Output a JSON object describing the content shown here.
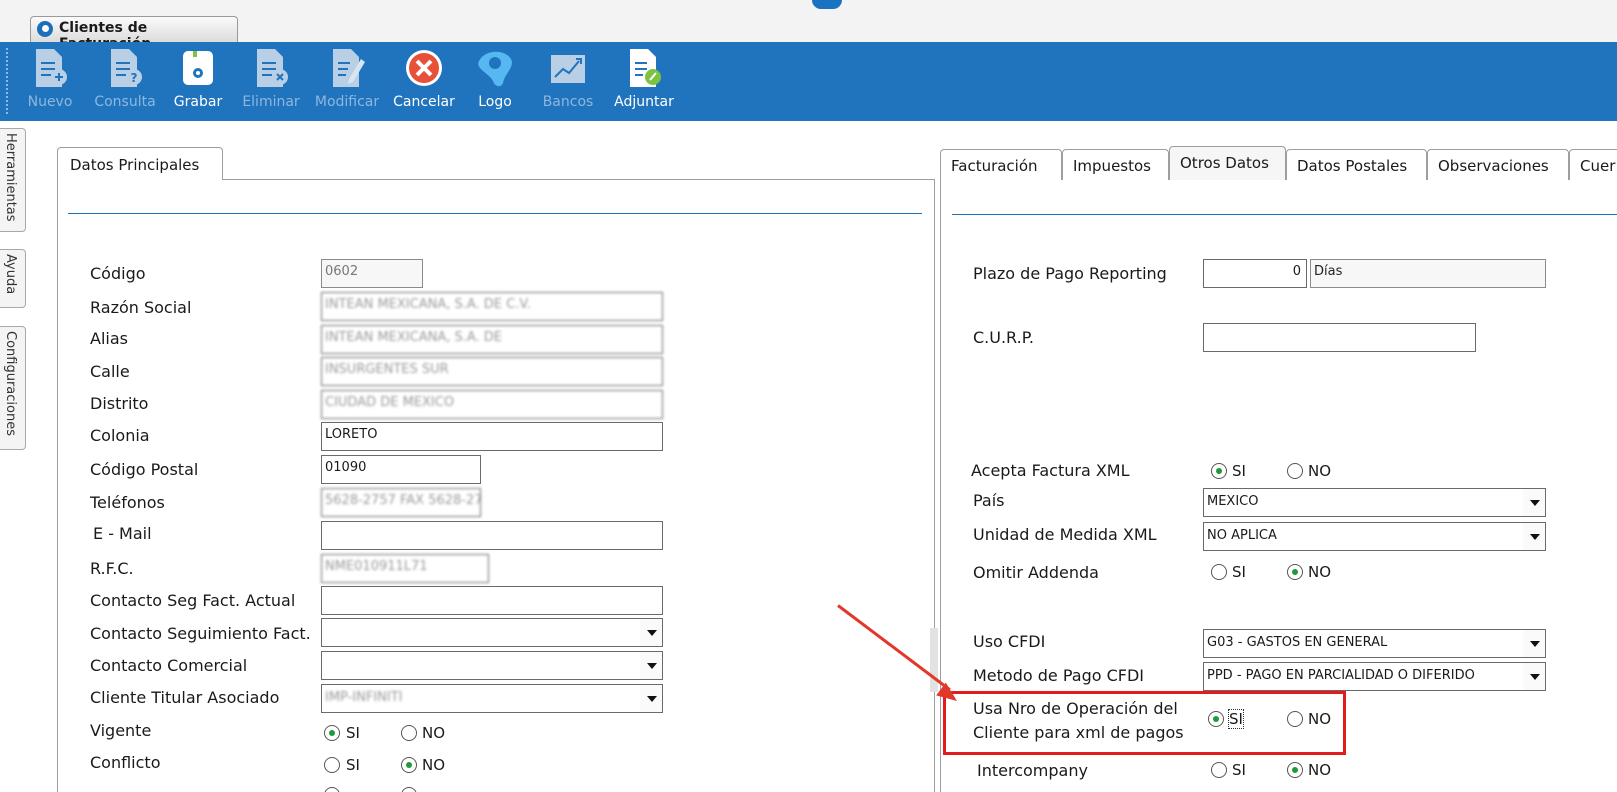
{
  "window": {
    "tab_title": "Clientes de Facturación"
  },
  "toolbar": {
    "buttons": [
      {
        "label": "Nuevo",
        "enabled": false,
        "icon": "document-add-icon"
      },
      {
        "label": "Consulta",
        "enabled": false,
        "icon": "document-query-icon"
      },
      {
        "label": "Grabar",
        "enabled": true,
        "icon": "save-icon"
      },
      {
        "label": "Eliminar",
        "enabled": false,
        "icon": "document-delete-icon"
      },
      {
        "label": "Modificar",
        "enabled": false,
        "icon": "document-edit-icon"
      },
      {
        "label": "Cancelar",
        "enabled": true,
        "icon": "cancel-icon"
      },
      {
        "label": "Logo",
        "enabled": true,
        "icon": "logo-icon"
      },
      {
        "label": "Bancos",
        "enabled": false,
        "icon": "chart-icon"
      },
      {
        "label": "Adjuntar",
        "enabled": true,
        "icon": "attach-icon"
      }
    ]
  },
  "side_tabs": [
    "Herramientas",
    "Ayuda",
    "Configuraciones"
  ],
  "left_panel": {
    "tab": "Datos Principales",
    "fields": {
      "codigo": {
        "label": "Código",
        "value": "0602"
      },
      "razon_social": {
        "label": "Razón Social",
        "value": "INTEAN MEXICANA, S.A. DE C.V."
      },
      "alias": {
        "label": "Alias",
        "value": "INTEAN MEXICANA, S.A. DE"
      },
      "calle": {
        "label": "Calle",
        "value": "INSURGENTES SUR"
      },
      "distrito": {
        "label": "Distrito",
        "value": "CIUDAD DE MEXICO"
      },
      "colonia": {
        "label": "Colonia",
        "value": "LORETO"
      },
      "codigo_postal": {
        "label": "Código Postal",
        "value": "01090"
      },
      "telefonos": {
        "label": "Teléfonos",
        "value": "5628-2757 FAX 5628-27"
      },
      "email": {
        "label": "E - Mail",
        "value": ""
      },
      "rfc": {
        "label": "R.F.C.",
        "value": "NME010911L71"
      },
      "contacto_seg_actual": {
        "label": "Contacto Seg Fact. Actual",
        "value": ""
      },
      "contacto_seguimiento": {
        "label": "Contacto Seguimiento Fact.",
        "value": ""
      },
      "contacto_comercial": {
        "label": "Contacto Comercial",
        "value": ""
      },
      "cliente_titular": {
        "label": "Cliente Titular Asociado",
        "value": "IMP-INFINITI"
      },
      "vigente": {
        "label": "Vigente",
        "selected": "SI"
      },
      "conflicto": {
        "label": "Conflicto",
        "selected": "NO"
      }
    },
    "radio_si": "SI",
    "radio_no": "NO"
  },
  "right_panel": {
    "tabs": [
      "Facturación",
      "Impuestos",
      "Otros Datos",
      "Datos Postales",
      "Observaciones",
      "Cuer"
    ],
    "active_tab": "Otros Datos",
    "fields": {
      "plazo_pago": {
        "label": "Plazo de Pago Reporting",
        "value": "0",
        "unit": "Días"
      },
      "curp": {
        "label": "C.U.R.P.",
        "value": ""
      },
      "acepta_xml": {
        "label": "Acepta Factura XML",
        "selected": "SI"
      },
      "pais": {
        "label": "País",
        "value": "MEXICO"
      },
      "unidad_medida": {
        "label": "Unidad de Medida XML",
        "value": "NO APLICA"
      },
      "omitir_addenda": {
        "label": "Omitir Addenda",
        "selected": "NO"
      },
      "uso_cfdi": {
        "label": "Uso CFDI",
        "value": "G03 - GASTOS EN GENERAL"
      },
      "metodo_pago": {
        "label": "Metodo de Pago CFDI",
        "value": "PPD - PAGO EN PARCIALIDAD O DIFERIDO"
      },
      "usa_nro_operacion": {
        "label_line1": "Usa Nro de Operación del",
        "label_line2": "Cliente para xml de pagos",
        "selected": "SI"
      },
      "intercompany": {
        "label": "Intercompany",
        "selected": "NO"
      }
    },
    "radio_si": "SI",
    "radio_no": "NO"
  },
  "colors": {
    "toolbar_bg": "#1f74bd",
    "highlight": "#e21c1c",
    "radio_selected": "#1f9a3a"
  }
}
